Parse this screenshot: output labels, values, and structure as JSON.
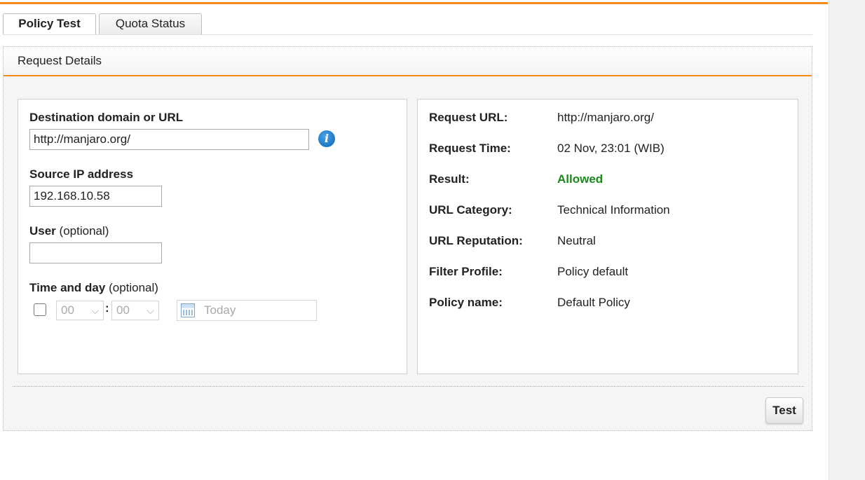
{
  "tabs": [
    {
      "label": "Policy Test",
      "active": true
    },
    {
      "label": "Quota Status",
      "active": false
    }
  ],
  "panel": {
    "title": "Request Details"
  },
  "form": {
    "destination": {
      "label": "Destination domain or URL",
      "value": "http://manjaro.org/",
      "info_icon": "info-icon"
    },
    "source_ip": {
      "label": "Source IP address",
      "value": "192.168.10.58"
    },
    "user": {
      "label": "User",
      "optional": "(optional)",
      "value": ""
    },
    "time_day": {
      "label": "Time and day",
      "optional": "(optional)",
      "checked": false,
      "hour": "00",
      "minute": "00",
      "separator": ":",
      "date_placeholder": "Today",
      "chevron": "⌵"
    }
  },
  "result": {
    "rows": [
      {
        "label": "Request URL:",
        "value": "http://manjaro.org/"
      },
      {
        "label": "Request Time:",
        "value": "02 Nov, 23:01 (WIB)"
      },
      {
        "label": "Result:",
        "value": "Allowed"
      },
      {
        "label": "URL Category:",
        "value": "Technical Information"
      },
      {
        "label": "URL Reputation:",
        "value": "Neutral"
      },
      {
        "label": "Filter Profile:",
        "value": "Policy default"
      },
      {
        "label": "Policy name:",
        "value": "Default Policy"
      }
    ]
  },
  "actions": {
    "test_label": "Test"
  },
  "colors": {
    "accent": "#f28c1b",
    "allowed": "#1b8a1b",
    "info": "#0b63b5"
  }
}
